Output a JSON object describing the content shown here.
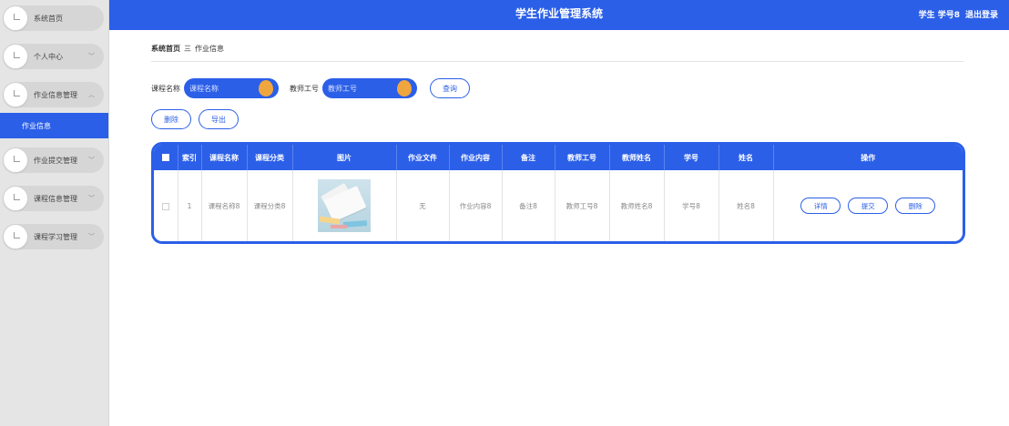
{
  "header": {
    "title": "学生作业管理系统",
    "user": "学生 学号8",
    "logout": "退出登录"
  },
  "sidebar": {
    "items": [
      {
        "label": "系统首页",
        "chevron": ""
      },
      {
        "label": "个人中心",
        "chevron": "﹀"
      },
      {
        "label": "作业信息管理",
        "chevron": "︿"
      },
      {
        "label": "作业提交管理",
        "chevron": "﹀"
      },
      {
        "label": "课程信息管理",
        "chevron": "﹀"
      },
      {
        "label": "课程学习管理",
        "chevron": "﹀"
      }
    ],
    "active_sub": "作业信息"
  },
  "breadcrumb": {
    "home": "系统首页",
    "separator": "三",
    "current": "作业信息"
  },
  "search": {
    "course_label": "课程名称",
    "course_placeholder": "课程名称",
    "teacher_label": "教师工号",
    "teacher_placeholder": "教师工号",
    "query_button": "查询"
  },
  "actions": {
    "delete": "删除",
    "export": "导出"
  },
  "table": {
    "headers": [
      "索引",
      "课程名称",
      "课程分类",
      "图片",
      "作业文件",
      "作业内容",
      "备注",
      "教师工号",
      "教师姓名",
      "学号",
      "姓名",
      "操作"
    ],
    "rows": [
      {
        "index": "1",
        "course_name": "课程名称8",
        "course_category": "课程分类8",
        "file": "无",
        "content": "作业内容8",
        "remark": "备注8",
        "teacher_id": "教师工号8",
        "teacher_name": "教师姓名8",
        "student_id": "学号8",
        "name": "姓名8",
        "ops": {
          "detail": "详情",
          "submit": "提交",
          "delete": "删除"
        }
      }
    ]
  },
  "colors": {
    "primary": "#2b5fe8",
    "knob": "#f0a63e",
    "sidebar_bg": "#e5e5e5"
  }
}
